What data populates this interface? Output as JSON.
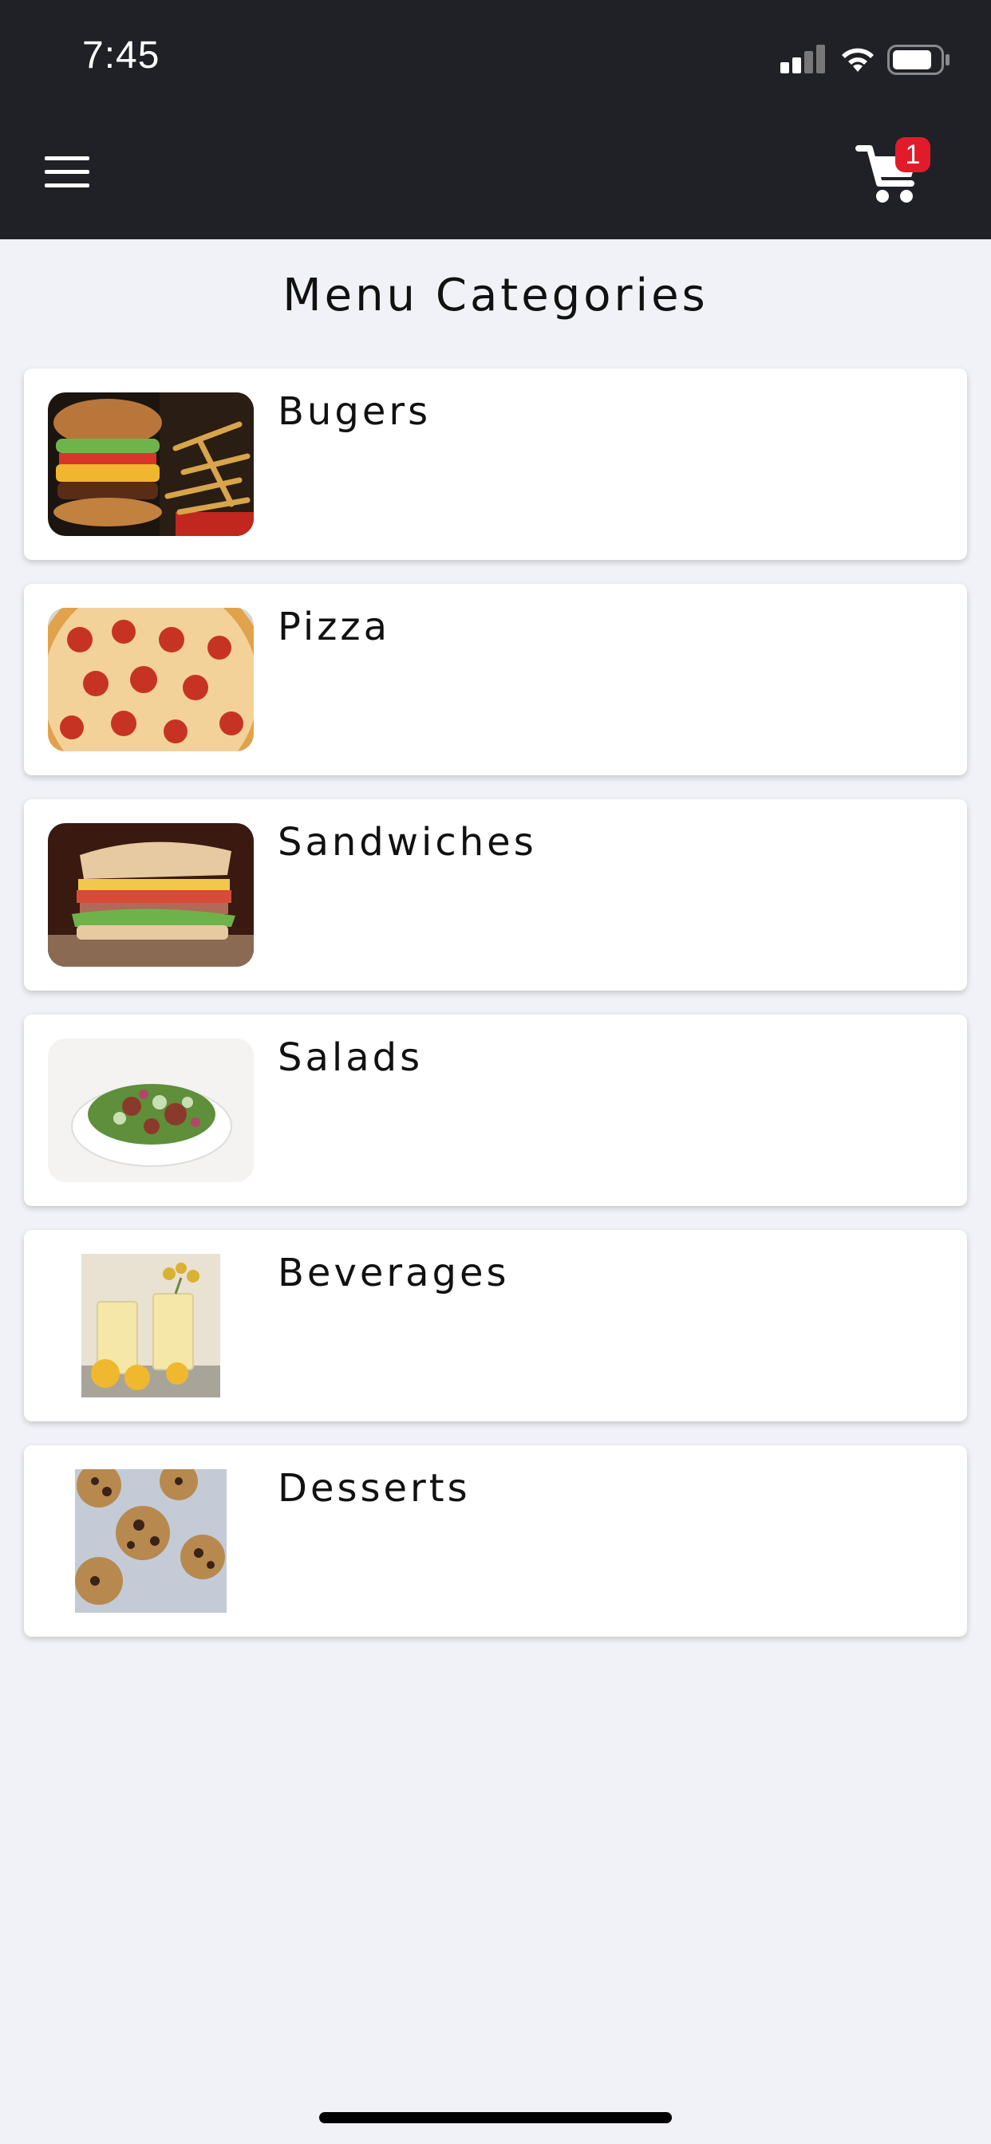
{
  "status_bar": {
    "time": "7:45"
  },
  "header": {
    "menu_icon": "hamburger-menu-icon",
    "cart_icon": "shopping-cart-icon",
    "cart_count": "1",
    "accent_color": "#e21b2a",
    "bar_color": "#202126"
  },
  "page": {
    "title": "Menu Categories"
  },
  "categories": [
    {
      "label": "Bugers",
      "image": "burger-photo"
    },
    {
      "label": "Pizza",
      "image": "pizza-photo"
    },
    {
      "label": "Sandwiches",
      "image": "sandwich-photo"
    },
    {
      "label": "Salads",
      "image": "salad-photo"
    },
    {
      "label": "Beverages",
      "image": "beverages-photo"
    },
    {
      "label": "Desserts",
      "image": "cookies-photo"
    }
  ]
}
